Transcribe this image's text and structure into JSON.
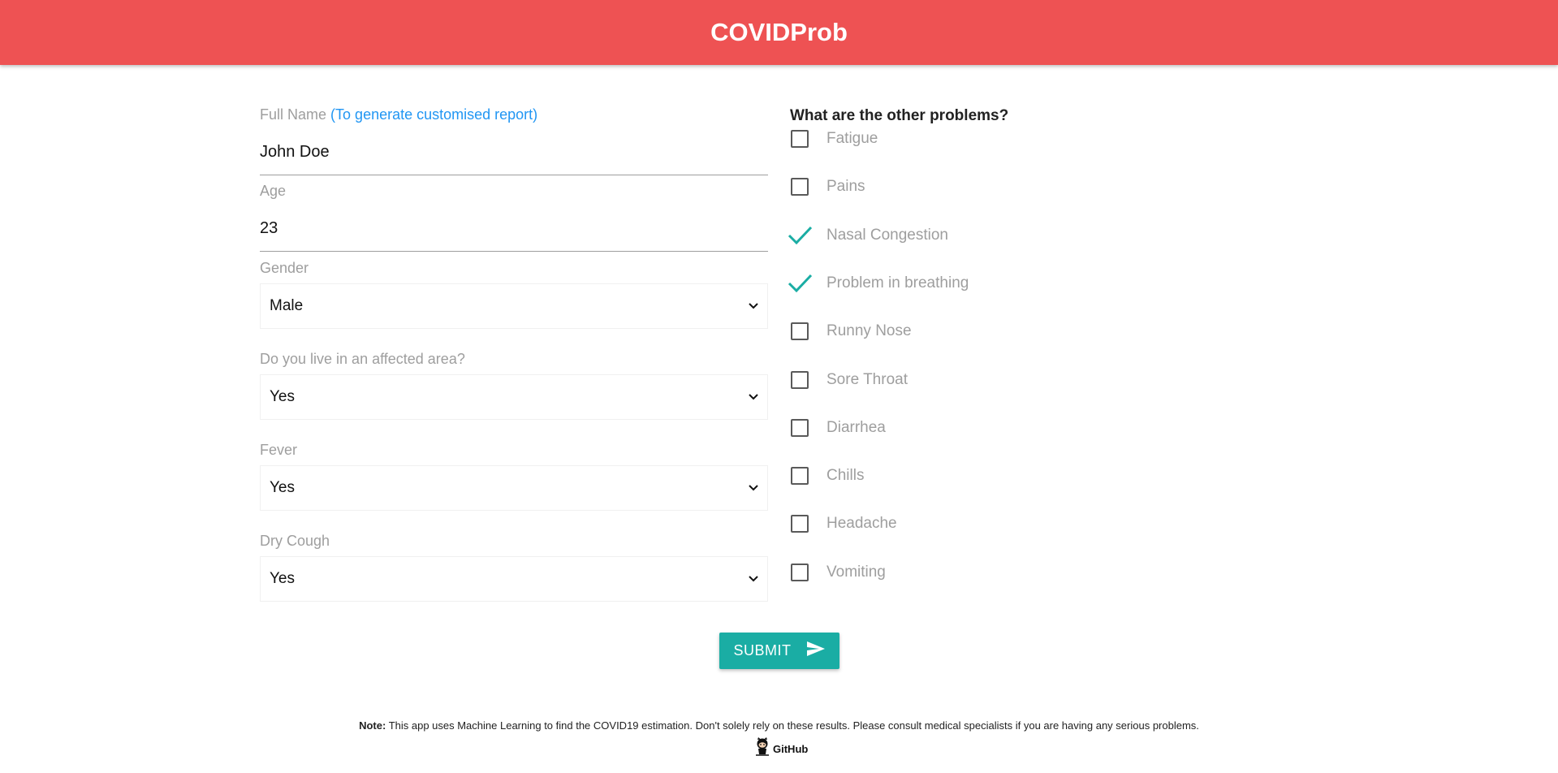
{
  "header": {
    "title": "COVIDProb"
  },
  "form": {
    "full_name": {
      "label": "Full Name",
      "hint": "(To generate customised report)",
      "value": "John Doe"
    },
    "age": {
      "label": "Age",
      "value": "23"
    },
    "gender": {
      "label": "Gender",
      "value": "Male"
    },
    "affected_area": {
      "label": "Do you live in an affected area?",
      "value": "Yes"
    },
    "fever": {
      "label": "Fever",
      "value": "Yes"
    },
    "dry_cough": {
      "label": "Dry Cough",
      "value": "Yes"
    }
  },
  "problems": {
    "title": "What are the other problems?",
    "items": [
      {
        "label": "Fatigue",
        "checked": false
      },
      {
        "label": "Pains",
        "checked": false
      },
      {
        "label": "Nasal Congestion",
        "checked": true
      },
      {
        "label": "Problem in breathing",
        "checked": true
      },
      {
        "label": "Runny Nose",
        "checked": false
      },
      {
        "label": "Sore Throat",
        "checked": false
      },
      {
        "label": "Diarrhea",
        "checked": false
      },
      {
        "label": "Chills",
        "checked": false
      },
      {
        "label": "Headache",
        "checked": false
      },
      {
        "label": "Vomiting",
        "checked": false
      }
    ]
  },
  "submit": {
    "label": "SUBMIT",
    "icon": "send-icon"
  },
  "footer": {
    "note_label": "Note:",
    "note_text": "This app uses Machine Learning to find the COVID19 estimation. Don't solely rely on these results. Please consult medical specialists if you are having any serious problems.",
    "github_label": "GitHub",
    "github_icon": "octocat-icon"
  },
  "colors": {
    "header_bg": "#ee5253",
    "accent": "#1aada4",
    "hint": "#2196f3",
    "label": "#9e9e9e"
  }
}
